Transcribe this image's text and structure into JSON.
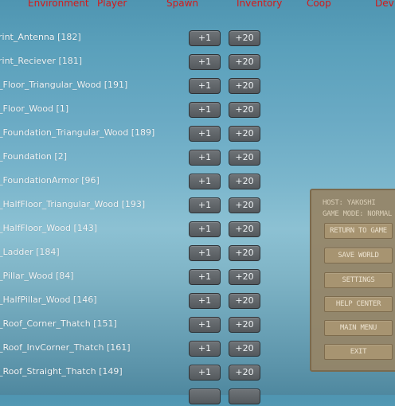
{
  "tabs": [
    "Environment",
    "Player",
    "Spawn",
    "Inventory",
    "Coop",
    "Dev"
  ],
  "items": [
    {
      "label": "rint_Antenna [182]",
      "add1": "+1",
      "add20": "+20"
    },
    {
      "label": "rint_Reciever [181]",
      "add1": "+1",
      "add20": "+20"
    },
    {
      "label": "_Floor_Triangular_Wood [191]",
      "add1": "+1",
      "add20": "+20"
    },
    {
      "label": "_Floor_Wood [1]",
      "add1": "+1",
      "add20": "+20"
    },
    {
      "label": "_Foundation_Triangular_Wood [189]",
      "add1": "+1",
      "add20": "+20"
    },
    {
      "label": "_Foundation [2]",
      "add1": "+1",
      "add20": "+20"
    },
    {
      "label": "_FoundationArmor [96]",
      "add1": "+1",
      "add20": "+20"
    },
    {
      "label": "_HalfFloor_Triangular_Wood [193]",
      "add1": "+1",
      "add20": "+20"
    },
    {
      "label": "_HalfFloor_Wood [143]",
      "add1": "+1",
      "add20": "+20"
    },
    {
      "label": "_Ladder [184]",
      "add1": "+1",
      "add20": "+20"
    },
    {
      "label": "_Pillar_Wood [84]",
      "add1": "+1",
      "add20": "+20"
    },
    {
      "label": "_HalfPillar_Wood [146]",
      "add1": "+1",
      "add20": "+20"
    },
    {
      "label": "_Roof_Corner_Thatch [151]",
      "add1": "+1",
      "add20": "+20"
    },
    {
      "label": "_Roof_InvCorner_Thatch [161]",
      "add1": "+1",
      "add20": "+20"
    },
    {
      "label": "_Roof_Straight_Thatch [149]",
      "add1": "+1",
      "add20": "+20"
    },
    {
      "label": "",
      "add1": "",
      "add20": ""
    }
  ],
  "pause_menu": {
    "host": "HOST: YAKOSHI",
    "game_mode": "GAME MODE: NORMAL",
    "buttons": [
      "RETURN TO GAME",
      "SAVE WORLD",
      "SETTINGS",
      "HELP CENTER",
      "MAIN MENU",
      "EXIT"
    ]
  }
}
